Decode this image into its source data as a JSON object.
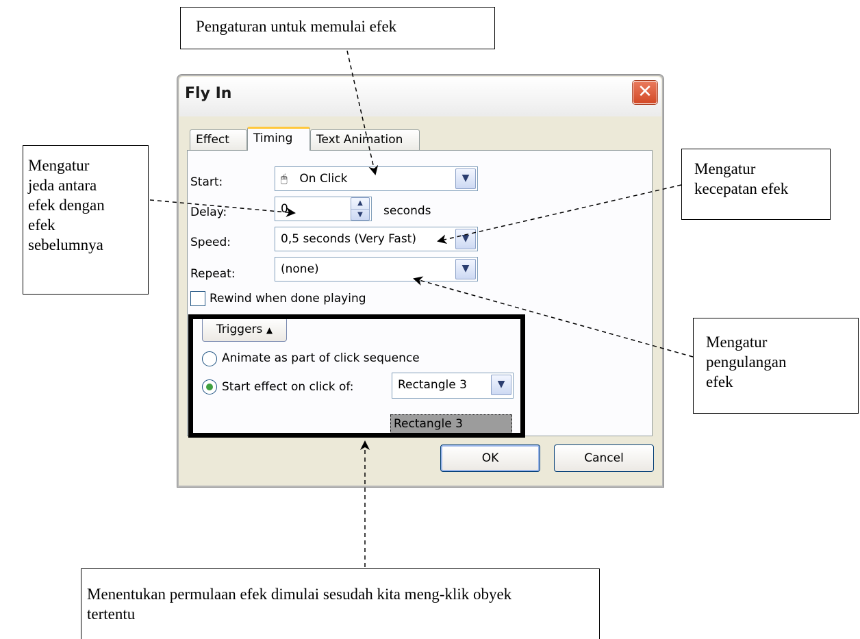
{
  "callouts": {
    "start_effect": "Pengaturan untuk memulai efek",
    "delay": "Mengatur\njeda antara\nefek dengan\nefek\nsebelumnya",
    "speed": "Mengatur\nkecepatan efek",
    "repeat": "Mengatur\npengulangan\nefek",
    "trigger": "Menentukan permulaan efek dimulai sesudah kita meng-klik obyek\ntertentu"
  },
  "dialog": {
    "title": "Fly In",
    "close_glyph": "✕",
    "tabs": [
      "Effect",
      "Timing",
      "Text Animation"
    ],
    "active_tab": "Timing",
    "start": {
      "label": "Start:",
      "value": "On Click",
      "icon": "mouse-click-icon"
    },
    "delay": {
      "label": "Delay:",
      "value": "0",
      "unit": "seconds"
    },
    "speed": {
      "label": "Speed:",
      "value": "0,5 seconds (Very Fast)"
    },
    "repeat": {
      "label": "Repeat:",
      "value": "(none)"
    },
    "rewind": {
      "label": "Rewind when done playing",
      "checked": false
    },
    "triggers": {
      "button_label": "Triggers",
      "option_animate": "Animate as part of click sequence",
      "option_start": "Start effect on click of:",
      "selected_option": "Start effect on click of:",
      "object_value": "Rectangle 3",
      "dropdown_items": [
        "Rectangle 3"
      ]
    },
    "ok_label": "OK",
    "cancel_label": "Cancel"
  }
}
